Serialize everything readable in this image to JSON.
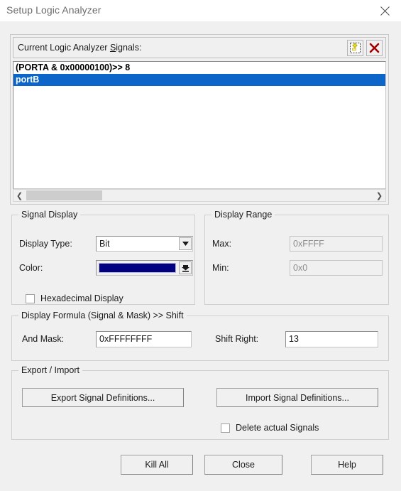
{
  "window": {
    "title": "Setup Logic Analyzer",
    "close_icon": "close-icon"
  },
  "signals_panel": {
    "header_label_prefix": "Current Logic Analyzer ",
    "header_label_accel": "S",
    "header_label_suffix": "ignals:",
    "new_signal_icon": "new-signal-icon",
    "delete_signal_icon": "delete-signal-icon",
    "items": [
      {
        "text": "(PORTA & 0x00000100)>> 8",
        "selected": false
      },
      {
        "text": "portB",
        "selected": true
      }
    ],
    "scrollbar": {
      "left_arrow": "❮",
      "right_arrow": "❯"
    }
  },
  "signal_display": {
    "legend": "Signal Display",
    "display_type_label": "Display Type:",
    "display_type_value": "Bit",
    "display_type_options": [
      "Bit"
    ],
    "color_label": "Color:",
    "color_value": "#000080",
    "hex_checkbox_label": "Hexadecimal Display",
    "hex_checkbox_checked": false
  },
  "display_range": {
    "legend": "Display Range",
    "max_label": "Max:",
    "max_value": "0xFFFF",
    "min_label": "Min:",
    "min_value": "0x0"
  },
  "display_formula": {
    "legend": "Display Formula (Signal & Mask) >> Shift",
    "and_mask_label": "And Mask:",
    "and_mask_value": "0xFFFFFFFF",
    "shift_right_label": "Shift Right:",
    "shift_right_value": "13"
  },
  "export_import": {
    "legend": "Export / Import",
    "export_label": "Export Signal Definitions...",
    "import_label": "Import Signal Definitions...",
    "delete_checkbox_label": "Delete actual Signals",
    "delete_checkbox_checked": false
  },
  "footer": {
    "kill_all_label": "Kill All",
    "close_label": "Close",
    "help_label": "Help"
  }
}
